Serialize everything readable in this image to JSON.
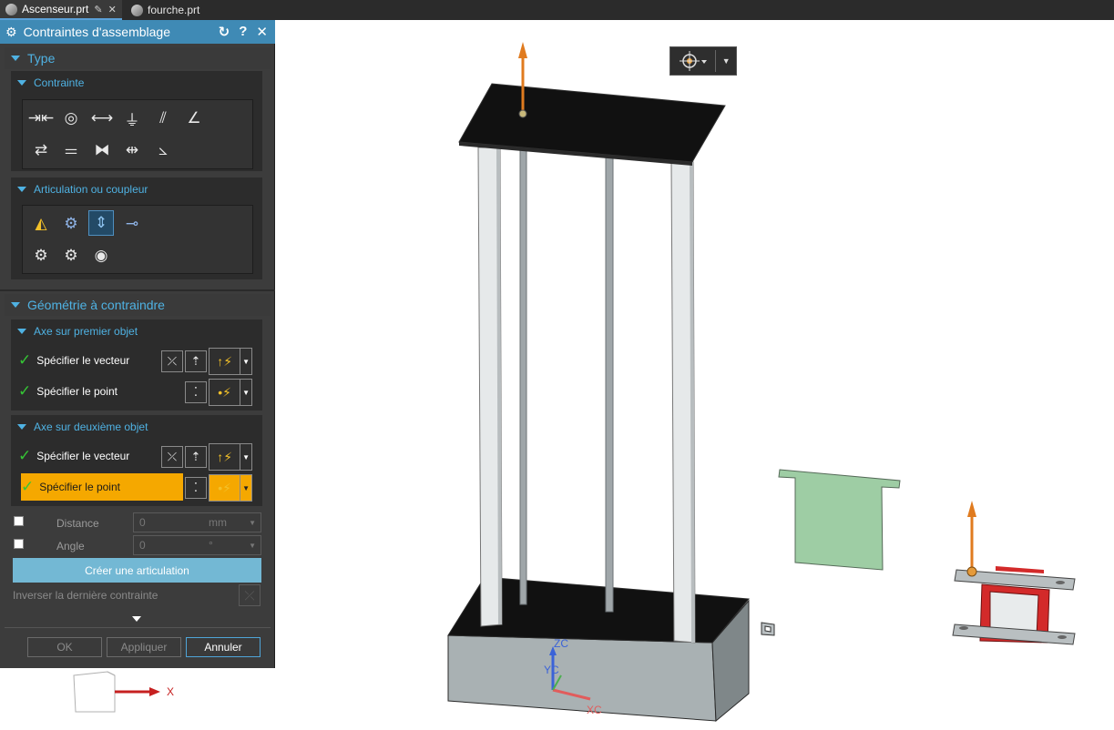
{
  "tabs": [
    {
      "label": "Ascenseur.prt",
      "icon": "part-file-icon",
      "active": true
    },
    {
      "label": "fourche.prt",
      "icon": "part-file-icon",
      "active": false
    }
  ],
  "dialog": {
    "title": "Contraintes d'assemblage",
    "type_section": "Type",
    "contrainte_section": "Contrainte",
    "contrainte_icons": [
      "touch-align-icon",
      "concentric-icon",
      "distance-icon",
      "fix-icon",
      "parallel-icon",
      "perpendicular-icon",
      "align-lock-icon",
      "equal-icon",
      "fit-icon",
      "center-icon",
      "angle-icon"
    ],
    "articulation_section": "Articulation ou coupleur",
    "articulation_icons": [
      "cam-joint-icon",
      "revolute-joint-icon",
      "slider-joint-icon",
      "cylindrical-joint-icon",
      "gear-coupler-icon",
      "rack-coupler-icon",
      "screw-coupler-icon"
    ],
    "geometry_section": "Géométrie à contraindre",
    "first_axis_section": "Axe sur premier objet",
    "second_axis_section": "Axe sur deuxième objet",
    "specify_vector": "Spécifier le vecteur",
    "specify_point": "Spécifier le point",
    "distance_label": "Distance",
    "distance_value": "0",
    "distance_unit": "mm",
    "angle_label": "Angle",
    "angle_value": "0",
    "angle_unit": "°",
    "create_button": "Créer une articulation",
    "invert_label": "Inverser la dernière contrainte",
    "ok": "OK",
    "apply": "Appliquer",
    "cancel": "Annuler"
  },
  "triad": {
    "x_label": "X"
  },
  "wcs": {
    "zc": "ZC",
    "yc": "YC",
    "xc": "XC"
  },
  "colors": {
    "accent": "#3f8ab5",
    "highlight": "#f5a800",
    "check": "#35c535",
    "section": "#4fb2e3"
  }
}
